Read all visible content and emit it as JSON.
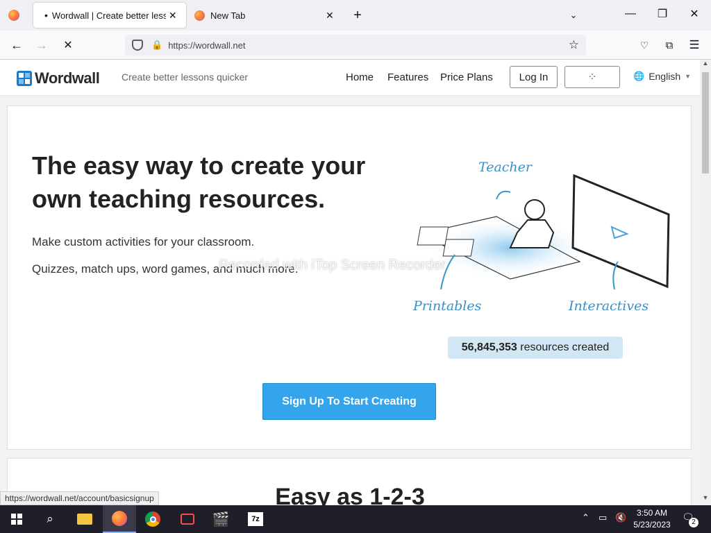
{
  "browser": {
    "tabs": [
      {
        "title": "Wordwall | Create better lesson",
        "dot": "•"
      },
      {
        "title": "New Tab"
      }
    ],
    "url": "https://wordwall.net",
    "status_url": "https://wordwall.net/account/basicsignup"
  },
  "site": {
    "brand": "Wordwall",
    "tagline": "Create better lessons quicker",
    "nav": [
      "Home",
      "Features",
      "Price Plans"
    ],
    "login_label": "Log In",
    "language": "English",
    "colors": {
      "brand": "#1f7ac6",
      "cta": "#34a5ec",
      "badge_bg": "#d2e6f3"
    }
  },
  "hero": {
    "headline_line1": "The easy way to create your",
    "headline_line2": "own teaching resources.",
    "sub1": "Make custom activities for your classroom.",
    "sub2": "Quizzes, match ups, word games, and much more.",
    "illustration_labels": {
      "teacher": "Teacher",
      "printables": "Printables",
      "interactives": "Interactives"
    },
    "resource_count": "56,845,353",
    "resource_suffix": "resources created",
    "cta": "Sign Up To Start Creating"
  },
  "section2": {
    "title": "Easy as 1-2-3"
  },
  "watermark": "Recorded with iTop Screen Recorder",
  "taskbar": {
    "time": "3:50 AM",
    "date": "5/23/2023",
    "notifications": "2"
  }
}
